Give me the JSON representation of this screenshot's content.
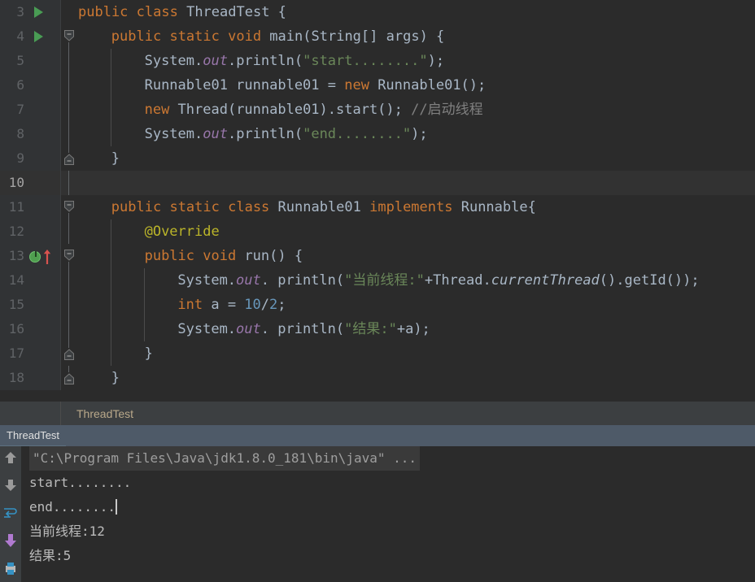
{
  "editor": {
    "first_visible_line": 3,
    "current_line": 10,
    "lines": [
      {
        "no": 3,
        "run_arrow": true,
        "fold": "none",
        "indent": 0,
        "tokens": [
          {
            "t": "public ",
            "c": "kw"
          },
          {
            "t": "class ",
            "c": "kw"
          },
          {
            "t": "ThreadTest",
            "c": "cls"
          },
          {
            "t": " {",
            "c": "id"
          }
        ]
      },
      {
        "no": 4,
        "run_arrow": true,
        "fold": "open-top",
        "indent": 1,
        "tokens": [
          {
            "t": "public ",
            "c": "kw"
          },
          {
            "t": "static ",
            "c": "kw"
          },
          {
            "t": "void ",
            "c": "kw"
          },
          {
            "t": "main",
            "c": "mth"
          },
          {
            "t": "(",
            "c": "id"
          },
          {
            "t": "String",
            "c": "cls"
          },
          {
            "t": "[] args) {",
            "c": "id"
          }
        ]
      },
      {
        "no": 5,
        "run_arrow": false,
        "fold": "bar",
        "indent": 2,
        "tokens": [
          {
            "t": "System.",
            "c": "id"
          },
          {
            "t": "out",
            "c": "fld"
          },
          {
            "t": ".println(",
            "c": "id"
          },
          {
            "t": "\"start........\"",
            "c": "str"
          },
          {
            "t": ");",
            "c": "id"
          }
        ]
      },
      {
        "no": 6,
        "run_arrow": false,
        "fold": "bar",
        "indent": 2,
        "tokens": [
          {
            "t": "Runnable01 runnable01 = ",
            "c": "id"
          },
          {
            "t": "new ",
            "c": "kw"
          },
          {
            "t": "Runnable01();",
            "c": "id"
          }
        ]
      },
      {
        "no": 7,
        "run_arrow": false,
        "fold": "bar",
        "indent": 2,
        "tokens": [
          {
            "t": "new ",
            "c": "kw"
          },
          {
            "t": "Thread(runnable01).start(); ",
            "c": "id"
          },
          {
            "t": "//启动线程",
            "c": "cmt"
          }
        ]
      },
      {
        "no": 8,
        "run_arrow": false,
        "fold": "bar",
        "indent": 2,
        "tokens": [
          {
            "t": "System.",
            "c": "id"
          },
          {
            "t": "out",
            "c": "fld"
          },
          {
            "t": ".println(",
            "c": "id"
          },
          {
            "t": "\"end........\"",
            "c": "str"
          },
          {
            "t": ");",
            "c": "id"
          }
        ]
      },
      {
        "no": 9,
        "run_arrow": false,
        "fold": "open-bottom",
        "indent": 1,
        "tokens": [
          {
            "t": "}",
            "c": "id"
          }
        ]
      },
      {
        "no": 10,
        "run_arrow": false,
        "fold": "bar",
        "indent": 0,
        "tokens": []
      },
      {
        "no": 11,
        "run_arrow": false,
        "fold": "open-top",
        "indent": 1,
        "tokens": [
          {
            "t": "public ",
            "c": "kw"
          },
          {
            "t": "static ",
            "c": "kw"
          },
          {
            "t": "class ",
            "c": "kw"
          },
          {
            "t": "Runnable01 ",
            "c": "cls"
          },
          {
            "t": "implements ",
            "c": "kw"
          },
          {
            "t": "Runnable",
            "c": "cls"
          },
          {
            "t": "{",
            "c": "id"
          }
        ]
      },
      {
        "no": 12,
        "run_arrow": false,
        "fold": "bar",
        "indent": 2,
        "tokens": [
          {
            "t": "@Override",
            "c": "ann"
          }
        ]
      },
      {
        "no": 13,
        "run_arrow": false,
        "fold": "open-top",
        "indent": 2,
        "info_icon": true,
        "tokens": [
          {
            "t": "public ",
            "c": "kw"
          },
          {
            "t": "void ",
            "c": "kw"
          },
          {
            "t": "run",
            "c": "mth"
          },
          {
            "t": "() {",
            "c": "id"
          }
        ]
      },
      {
        "no": 14,
        "run_arrow": false,
        "fold": "bar",
        "indent": 3,
        "tokens": [
          {
            "t": "System.",
            "c": "id"
          },
          {
            "t": "out",
            "c": "fld"
          },
          {
            "t": ". println(",
            "c": "id"
          },
          {
            "t": "\"当前线程:\"",
            "c": "str"
          },
          {
            "t": "+Thread.",
            "c": "id"
          },
          {
            "t": "currentThread",
            "c": "stm"
          },
          {
            "t": "().getId());",
            "c": "id"
          }
        ]
      },
      {
        "no": 15,
        "run_arrow": false,
        "fold": "bar",
        "indent": 3,
        "tokens": [
          {
            "t": "int ",
            "c": "kw"
          },
          {
            "t": "a = ",
            "c": "id"
          },
          {
            "t": "10",
            "c": "num"
          },
          {
            "t": "/",
            "c": "id"
          },
          {
            "t": "2",
            "c": "num"
          },
          {
            "t": ";",
            "c": "id"
          }
        ]
      },
      {
        "no": 16,
        "run_arrow": false,
        "fold": "bar",
        "indent": 3,
        "tokens": [
          {
            "t": "System.",
            "c": "id"
          },
          {
            "t": "out",
            "c": "fld"
          },
          {
            "t": ". println(",
            "c": "id"
          },
          {
            "t": "\"结果:\"",
            "c": "str"
          },
          {
            "t": "+a);",
            "c": "id"
          }
        ]
      },
      {
        "no": 17,
        "run_arrow": false,
        "fold": "open-bottom",
        "indent": 2,
        "tokens": [
          {
            "t": "}",
            "c": "id"
          }
        ]
      },
      {
        "no": 18,
        "run_arrow": false,
        "fold": "open-bottom",
        "indent": 1,
        "tokens": [
          {
            "t": "}",
            "c": "id"
          }
        ]
      }
    ]
  },
  "breadcrumb": {
    "label": "ThreadTest"
  },
  "run_tab": {
    "label": "ThreadTest"
  },
  "console": {
    "command_line": "\"C:\\Program Files\\Java\\jdk1.8.0_181\\bin\\java\" ...",
    "output_lines": [
      {
        "text": "start........",
        "caret": false
      },
      {
        "text": "end........",
        "caret": true
      },
      {
        "text": "当前线程:12",
        "caret": false
      },
      {
        "text": "结果:5",
        "caret": false
      }
    ],
    "toolbar_icons": [
      {
        "name": "scroll-up-icon",
        "glyph": "up",
        "color": "#9a9a9a"
      },
      {
        "name": "scroll-down-icon",
        "glyph": "down",
        "color": "#9a9a9a"
      },
      {
        "name": "soft-wrap-icon",
        "glyph": "wrap",
        "color": "#3592c4"
      },
      {
        "name": "export-icon",
        "glyph": "export",
        "color": "#b07ad0"
      },
      {
        "name": "print-icon",
        "glyph": "print",
        "color": "#3592c4"
      }
    ]
  },
  "colors": {
    "editor_bg": "#2b2b2b",
    "gutter_bg": "#313335",
    "current_line_bg": "#323232",
    "keyword": "#cc7832",
    "string": "#6a8759",
    "number": "#6897bb",
    "comment": "#808080",
    "annotation": "#bbb529",
    "static_field": "#9876aa",
    "identifier": "#a9b7c6",
    "run_tab_selected": "#4e5a68",
    "breadcrumb_text": "#b9a88a",
    "console_text": "#bbbbbb",
    "run_arrow_green": "#499c54"
  }
}
